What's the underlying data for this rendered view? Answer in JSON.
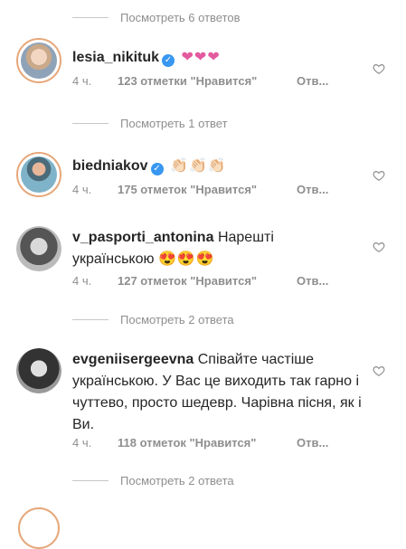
{
  "thread": {
    "replies_top": "Посмотреть 6 ответов",
    "comments": [
      {
        "username": "lesia_nikituk",
        "verified": true,
        "text": "",
        "emoji": "❤❤❤",
        "time": "4 ч.",
        "likes": "123 отметки \"Нравится\"",
        "reply": "Отв...",
        "view_replies": "Посмотреть 1 ответ"
      },
      {
        "username": "biedniakov",
        "verified": true,
        "text": "",
        "emoji": "👏🏻👏🏻👏🏻",
        "time": "4 ч.",
        "likes": "175 отметок \"Нравится\"",
        "reply": "Отв...",
        "view_replies": ""
      },
      {
        "username": "v_pasporti_antonina",
        "verified": false,
        "text": "Нарешті українською",
        "emoji": "😍😍😍",
        "time": "4 ч.",
        "likes": "127 отметок \"Нравится\"",
        "reply": "Отв...",
        "view_replies": "Посмотреть 2 ответа"
      },
      {
        "username": "evgeniisergeevna",
        "verified": false,
        "text": "Співайте частіше українською. У Вас це виходить так гарно і чуттево, просто шедевр. Чарівна пісня, як і Ви.",
        "emoji": "",
        "time": "4 ч.",
        "likes": "118 отметок \"Нравится\"",
        "reply": "Отв...",
        "view_replies": "Посмотреть 2 ответа"
      }
    ]
  },
  "icons": {
    "like": "heart-outline-icon",
    "verified": "verified-badge-icon"
  },
  "colors": {
    "muted": "#8e8e8e",
    "verified": "#3897f0",
    "heart": "#e35a9f"
  }
}
